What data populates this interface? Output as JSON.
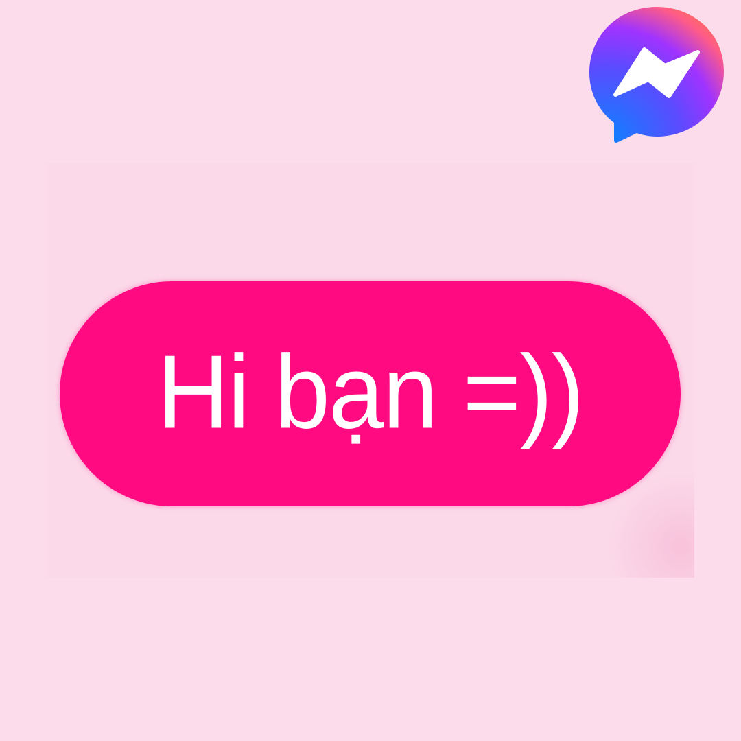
{
  "message": {
    "text": "Hi bạn =))",
    "bubble_color": "#ff0a80",
    "text_color": "#ffffff"
  },
  "background": {
    "color": "#fcdcea",
    "panel_color": "#fbd9e9"
  },
  "logo": {
    "icon": "messenger-logo-icon",
    "gradient_colors": [
      "#0a84ff",
      "#a033ff",
      "#ff5c87",
      "#ff7a3d"
    ],
    "bolt_color": "#ffffff"
  }
}
